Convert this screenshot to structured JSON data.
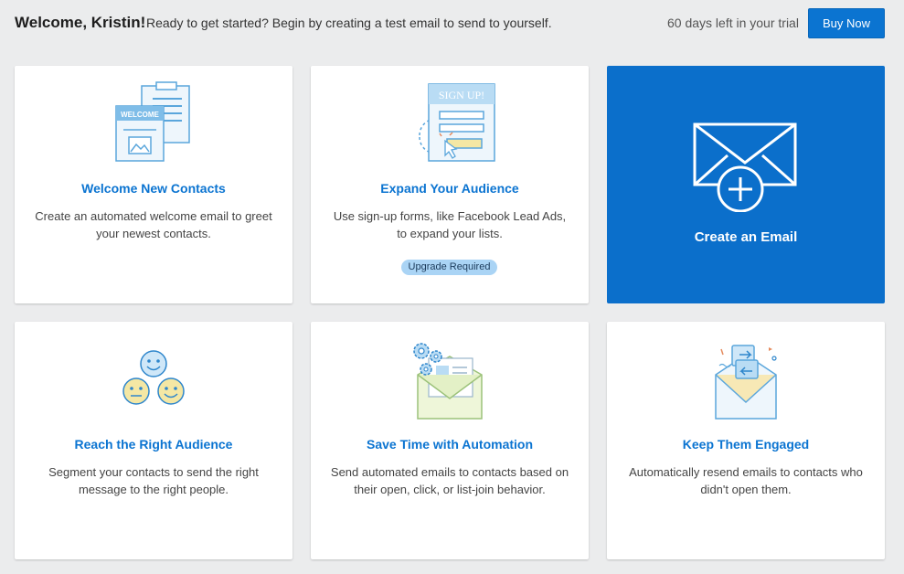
{
  "header": {
    "welcome": "Welcome, Kristin!",
    "subtitle": "Ready to get started? Begin by creating a test email to send to yourself.",
    "trial_text": "60 days left in your trial",
    "buy_label": "Buy Now"
  },
  "cards": [
    {
      "title": "Welcome New Contacts",
      "description": "Create an automated welcome email to greet your newest contacts.",
      "illustration_text": "WELCOME",
      "icon": "welcome-forms-icon"
    },
    {
      "title": "Expand Your Audience",
      "description": "Use sign-up forms, like Facebook Lead Ads, to expand your lists.",
      "badge": "Upgrade Required",
      "illustration_text": "SIGN UP!",
      "icon": "signup-form-icon"
    },
    {
      "title": "Create an Email",
      "icon": "envelope-plus-icon"
    },
    {
      "title": "Reach the Right Audience",
      "description": "Segment your contacts to send the right message to the right people.",
      "icon": "audience-faces-icon"
    },
    {
      "title": "Save Time with Automation",
      "description": "Send automated emails to contacts based on their open, click, or list-join behavior.",
      "icon": "automation-gears-icon"
    },
    {
      "title": "Keep Them Engaged",
      "description": "Automatically resend emails to contacts who didn't open them.",
      "icon": "resend-envelope-icon"
    }
  ],
  "colors": {
    "accent": "#0b74d1",
    "primary_card": "#0b6fcb",
    "background": "#ebeced",
    "badge": "#aad4f5"
  }
}
